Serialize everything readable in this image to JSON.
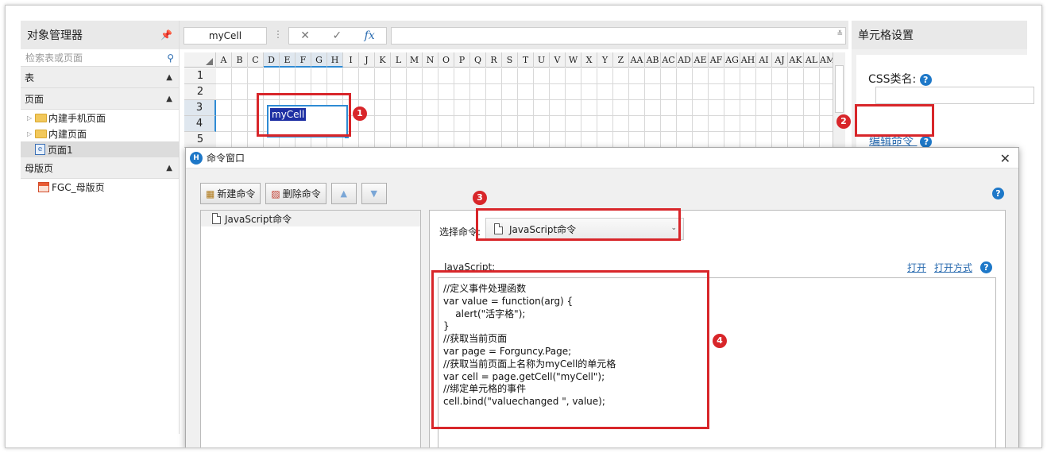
{
  "left_panel": {
    "title": "对象管理器",
    "search_placeholder": "检索表或页面",
    "sections": {
      "tables": "表",
      "pages": "页面",
      "masters": "母版页"
    },
    "page_items": [
      "内建手机页面",
      "内建页面",
      "页面1"
    ],
    "master_items": [
      "FGC_母版页"
    ]
  },
  "toolbar": {
    "name_box": "myCell",
    "formula_value": ""
  },
  "grid": {
    "columns": [
      "A",
      "B",
      "C",
      "D",
      "E",
      "F",
      "G",
      "H",
      "I",
      "J",
      "K",
      "L",
      "M",
      "N",
      "O",
      "P",
      "Q",
      "R",
      "S",
      "T",
      "U",
      "V",
      "W",
      "X",
      "Y",
      "Z",
      "AA",
      "AB",
      "AC",
      "AD",
      "AE",
      "AF",
      "AG",
      "AH",
      "AI",
      "AJ",
      "AK",
      "AL",
      "AM"
    ],
    "rows": [
      "1",
      "2",
      "3",
      "4",
      "5"
    ],
    "selected_cell_text": "myCell"
  },
  "right_panel": {
    "title": "单元格设置",
    "css_label": "CSS类名:",
    "edit_command": "编辑命令",
    "css_value": ""
  },
  "dialog": {
    "title": "命令窗口",
    "new_button": "新建命令",
    "delete_button": "删除命令",
    "command_items": [
      "JavaScript命令"
    ],
    "select_label": "选择命令:",
    "select_value": "JavaScript命令",
    "js_label": "JavaScript:",
    "open_link": "打开",
    "open_with_link": "打开方式",
    "code_lines": [
      "//定义事件处理函数",
      "var value = function(arg) {",
      "    alert(\"活字格\");",
      "}",
      "//获取当前页面",
      "var page = Forguncy.Page;",
      "//获取当前页面上名称为myCell的单元格",
      "var cell = page.getCell(\"myCell\");",
      "//绑定单元格的事件",
      "cell.bind(\"valuechanged \", value);"
    ]
  },
  "annotations": [
    "1",
    "2",
    "3",
    "4"
  ],
  "colors": {
    "annotation_red": "#d8262a",
    "accent_blue": "#1e78c8",
    "selection_blue": "#1d2fa3"
  }
}
